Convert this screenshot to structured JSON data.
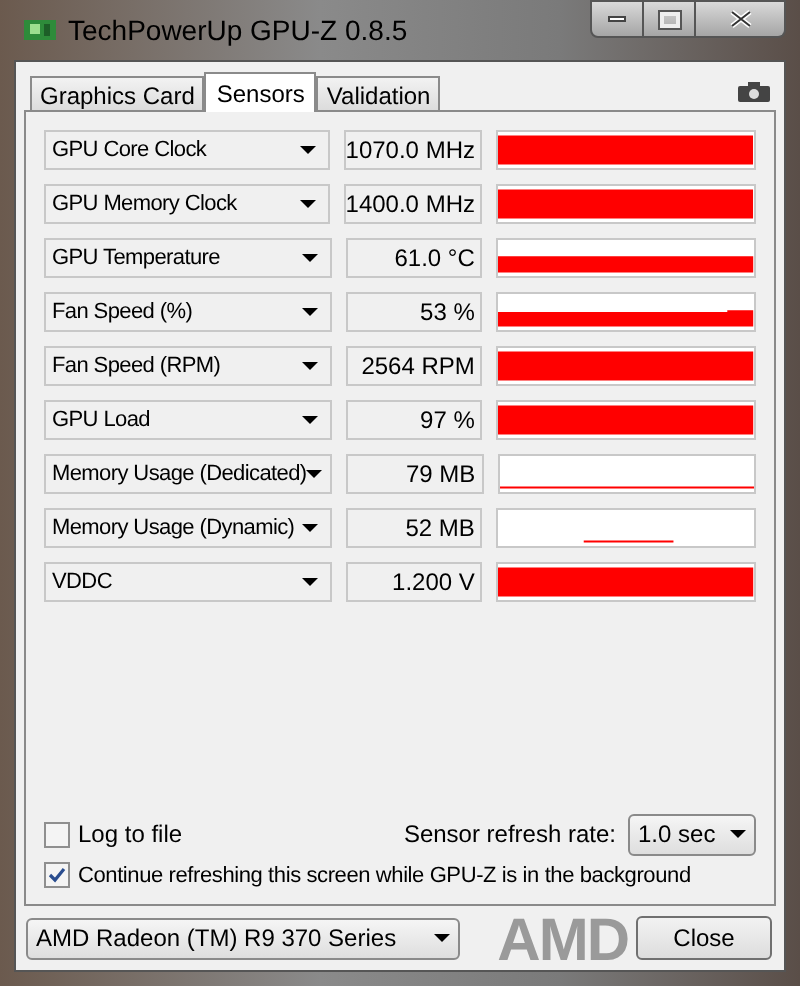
{
  "window": {
    "title": "TechPowerUp GPU-Z 0.8.5"
  },
  "tabs": [
    {
      "label": "Graphics Card",
      "selected": false
    },
    {
      "label": "Sensors",
      "selected": true
    },
    {
      "label": "Validation",
      "selected": false
    }
  ],
  "sensors": [
    {
      "name": "GPU Core Clock",
      "value": "1070.0 MHz"
    },
    {
      "name": "GPU Memory Clock",
      "value": "1400.0 MHz"
    },
    {
      "name": "GPU Temperature",
      "value": "61.0 °C"
    },
    {
      "name": "Fan Speed (%)",
      "value": "53 %"
    },
    {
      "name": "Fan Speed (RPM)",
      "value": "2564 RPM"
    },
    {
      "name": "GPU Load",
      "value": "97 %"
    },
    {
      "name": "Memory Usage (Dedicated)",
      "value": "79 MB"
    },
    {
      "name": "Memory Usage (Dynamic)",
      "value": "52 MB"
    },
    {
      "name": "VDDC",
      "value": "1.200 V"
    }
  ],
  "log_to_file": {
    "label": "Log to file",
    "checked": false
  },
  "refresh_rate": {
    "label": "Sensor refresh rate:",
    "value": "1.0 sec"
  },
  "continue_refreshing": {
    "label": "Continue refreshing this screen while GPU-Z is in the background",
    "checked": true
  },
  "gpu_select": {
    "value": "AMD Radeon (TM) R9 370 Series"
  },
  "logo": "AMD",
  "close_button": "Close"
}
